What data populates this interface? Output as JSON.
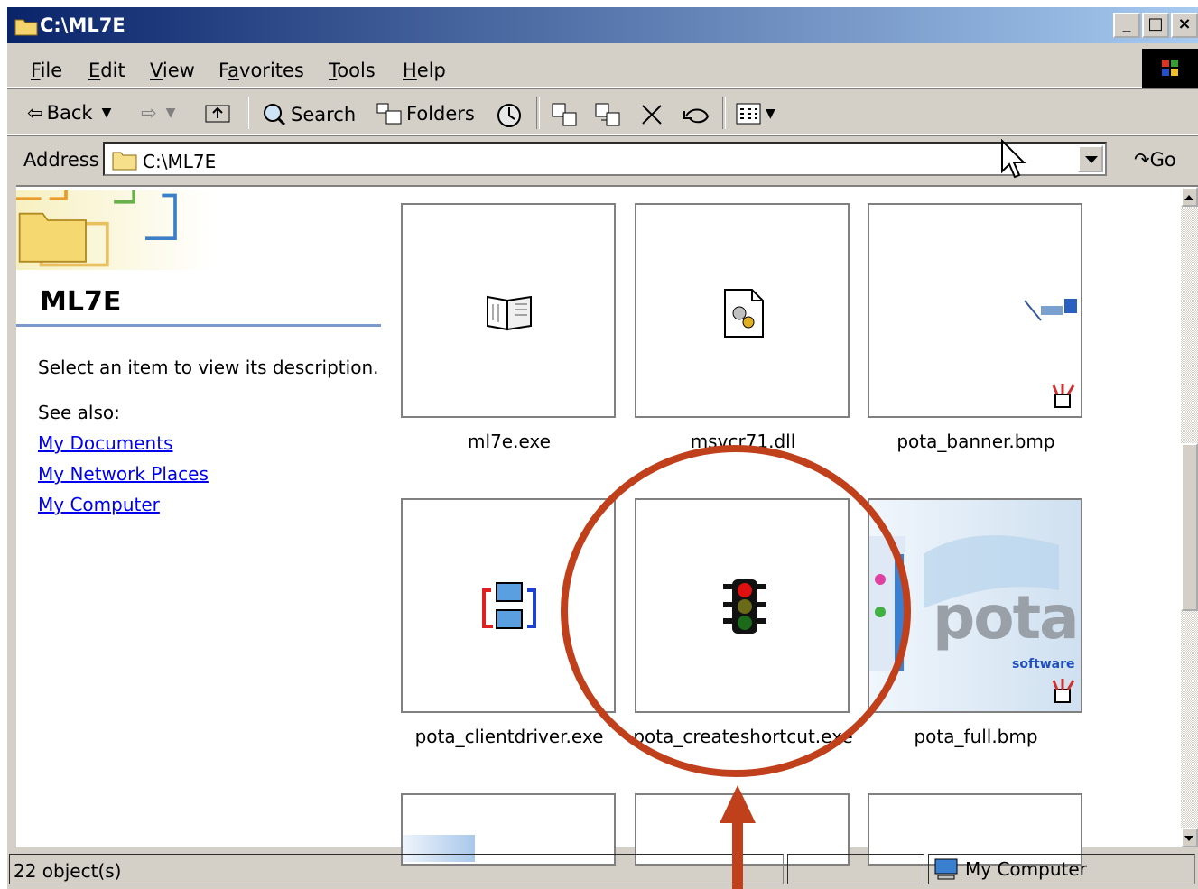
{
  "window": {
    "title": "C:\\ML7E",
    "min_label": "_",
    "max_label": "□",
    "close_label": "×"
  },
  "menu": [
    {
      "label": "File",
      "underline": "F",
      "rest": "ile"
    },
    {
      "label": "Edit",
      "underline": "E",
      "rest": "dit"
    },
    {
      "label": "View",
      "underline": "V",
      "rest": "iew"
    },
    {
      "label": "Favorites",
      "pre": "F",
      "underline": "a",
      "rest": "vorites"
    },
    {
      "label": "Tools",
      "underline": "T",
      "rest": "ools"
    },
    {
      "label": "Help",
      "underline": "H",
      "rest": "elp"
    }
  ],
  "toolbar": {
    "back": "Back",
    "search": "Search",
    "folders": "Folders"
  },
  "address": {
    "label": "Address",
    "value": "C:\\ML7E",
    "go": "Go"
  },
  "leftpane": {
    "title": "ML7E",
    "description": "Select an item to view its description.",
    "see_also": "See also:",
    "links": [
      "My Documents",
      "My Network Places",
      "My Computer"
    ]
  },
  "files": [
    {
      "name": "ml7e.exe",
      "icon": "book-icon"
    },
    {
      "name": "msvcr71.dll",
      "icon": "dll-gear-icon"
    },
    {
      "name": "pota_banner.bmp",
      "icon": "bitmap-thumbnail"
    },
    {
      "name": "pota_clientdriver.exe",
      "icon": "network-computers-icon"
    },
    {
      "name": "pota_createshortcut.exe",
      "icon": "traffic-light-icon"
    },
    {
      "name": "pota_full.bmp",
      "icon": "pota-logo-thumbnail"
    }
  ],
  "pota_full_thumb": {
    "brand": "pota",
    "sub": "software"
  },
  "status": {
    "count": "22 object(s)",
    "zone": "My Computer"
  },
  "colors": {
    "titlebar_start": "#0a246a",
    "titlebar_end": "#a6caf0",
    "annotation": "#c0401c",
    "link": "#0000ee"
  }
}
